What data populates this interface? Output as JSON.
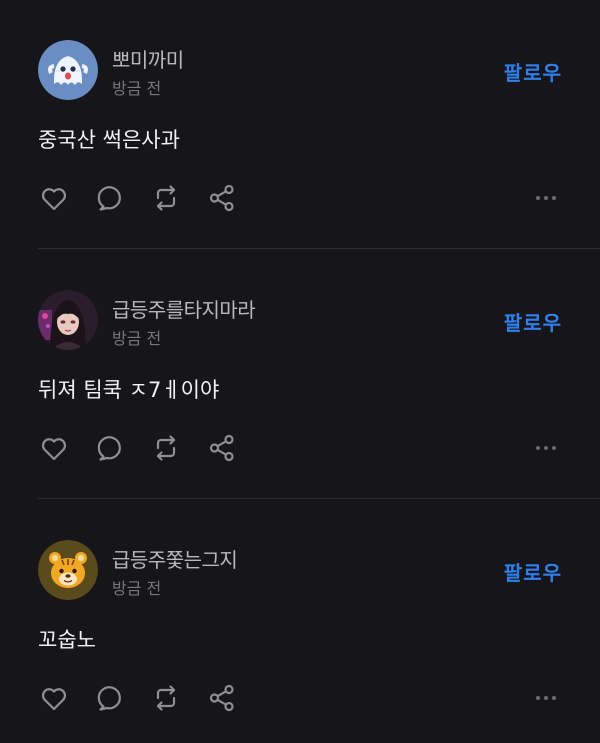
{
  "posts": [
    {
      "username": "뽀미까미",
      "timestamp": "방금 전",
      "follow_label": "팔로우",
      "content": "중국산 썩은사과",
      "avatar_icon": "ghost-avatar-icon"
    },
    {
      "username": "급등주를타지마라",
      "timestamp": "방금 전",
      "follow_label": "팔로우",
      "content": "뒤져 팀쿡 ㅈ7ㅔ이야",
      "avatar_icon": "anime-girl-avatar-icon"
    },
    {
      "username": "급등주쫓는그지",
      "timestamp": "방금 전",
      "follow_label": "팔로우",
      "content": "꼬숩노",
      "avatar_icon": "tiger-avatar-icon"
    }
  ],
  "colors": {
    "background": "#16161a",
    "follow": "#2f80ed",
    "username": "#b9b9bd",
    "timestamp": "#76767c",
    "icon": "#8e8e93"
  }
}
